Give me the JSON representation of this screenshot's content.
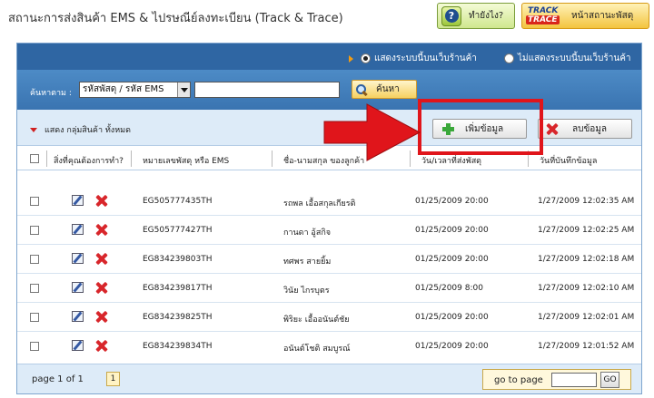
{
  "header": {
    "title": "สถานะการส่งสินค้า EMS & ไปรษณีย์ลงทะเบียน (Track & Trace)",
    "help_label": "ทำยังไง?",
    "track_logo_top": "TRACK",
    "track_logo_bottom": "TRACE",
    "status_label": "หน้าสถานะพัสดุ"
  },
  "options": {
    "show_on_site": "แสดงระบบนี้บนเว็บร้านค้า",
    "hide_on_site": "ไม่แสดงระบบนี้บนเว็บร้านค้า",
    "selected": "show_on_site"
  },
  "search": {
    "label": "ค้นหาตาม :",
    "select_value": "รหัสพัสดุ / รหัส EMS",
    "input_value": "",
    "button_label": "ค้นหา"
  },
  "actions": {
    "group_label": "แสดง กลุ่มสินค้า ทั้งหมด",
    "add_label": "เพิ่มข้อมูล",
    "delete_label": "ลบข้อมูล"
  },
  "table": {
    "columns": [
      "สิ่งที่คุณต้องการทำ?",
      "หมายเลขพัสดุ หรือ EMS",
      "ชื่อ-นามสกุล ของลูกค้า",
      "วัน/เวลาที่ส่งพัสดุ",
      "วันที่บันทึกข้อมูล"
    ],
    "rows": [
      {
        "tracking": "EG505777435TH",
        "customer": "รถพล เอื้อสกุลเกียรติ",
        "sent": "01/25/2009 20:00",
        "recorded": "1/27/2009 12:02:35 AM"
      },
      {
        "tracking": "EG505777427TH",
        "customer": "กานดา อู้สกิจ",
        "sent": "01/25/2009 20:00",
        "recorded": "1/27/2009 12:02:25 AM"
      },
      {
        "tracking": "EG834239803TH",
        "customer": "ทศพร สายยิ้ม",
        "sent": "01/25/2009 20:00",
        "recorded": "1/27/2009 12:02:18 AM"
      },
      {
        "tracking": "EG834239817TH",
        "customer": "วินัย ไกรบุตร",
        "sent": "01/25/2009 8:00",
        "recorded": "1/27/2009 12:02:10 AM"
      },
      {
        "tracking": "EG834239825TH",
        "customer": "พิริยะ เอื้ออนันต์ชัย",
        "sent": "01/25/2009 20:00",
        "recorded": "1/27/2009 12:02:01 AM"
      },
      {
        "tracking": "EG834239834TH",
        "customer": "อนันต์โชติ สมบูรณ์",
        "sent": "01/25/2009 20:00",
        "recorded": "1/27/2009 12:01:52 AM"
      }
    ]
  },
  "footer": {
    "page_info": "page 1 of 1",
    "current_page": "1",
    "goto_label": "go to page",
    "goto_value": "",
    "goto_button": "GO"
  },
  "colors": {
    "header_blue": "#2f66a3",
    "annotation_red": "#e0151b",
    "add_icon_green": "#3aa83a",
    "delete_icon_red": "#d8262b"
  },
  "icons": [
    "help-icon",
    "track-trace-logo",
    "search-icon",
    "plus-icon",
    "delete-x-icon",
    "edit-icon"
  ]
}
